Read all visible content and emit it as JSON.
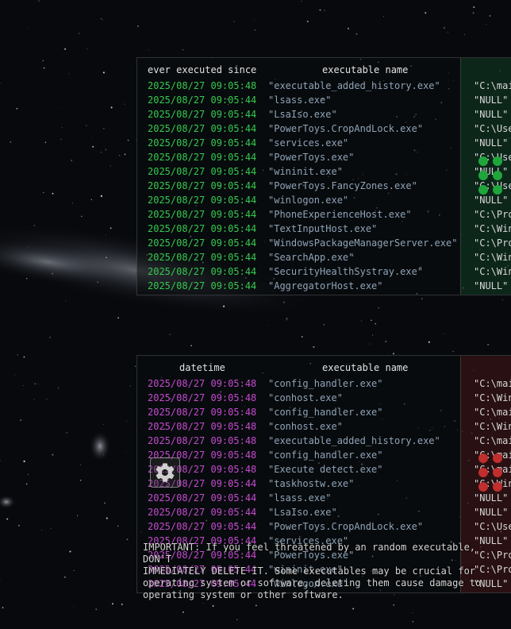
{
  "top_table": {
    "headers": [
      "ever executed since",
      "executable name"
    ],
    "rows": [
      {
        "date": "2025/08/27 09:05:48",
        "name": "\"executable_added_history.exe\"",
        "path": "\"C:\\mai"
      },
      {
        "date": "2025/08/27 09:05:44",
        "name": "\"lsass.exe\"",
        "path": "\"NULL\""
      },
      {
        "date": "2025/08/27 09:05:44",
        "name": "\"LsaIso.exe\"",
        "path": "\"NULL\""
      },
      {
        "date": "2025/08/27 09:05:44",
        "name": "\"PowerToys.CropAndLock.exe\"",
        "path": "\"C:\\Use"
      },
      {
        "date": "2025/08/27 09:05:44",
        "name": "\"services.exe\"",
        "path": "\"NULL\""
      },
      {
        "date": "2025/08/27 09:05:44",
        "name": "\"PowerToys.exe\"",
        "path": "\"C:\\Use"
      },
      {
        "date": "2025/08/27 09:05:44",
        "name": "\"wininit.exe\"",
        "path": "\"NULL\""
      },
      {
        "date": "2025/08/27 09:05:44",
        "name": "\"PowerToys.FancyZones.exe\"",
        "path": "\"C:\\Use"
      },
      {
        "date": "2025/08/27 09:05:44",
        "name": "\"winlogon.exe\"",
        "path": "\"NULL\""
      },
      {
        "date": "2025/08/27 09:05:44",
        "name": "\"PhoneExperienceHost.exe\"",
        "path": "\"C:\\Pro"
      },
      {
        "date": "2025/08/27 09:05:44",
        "name": "\"TextInputHost.exe\"",
        "path": "\"C:\\Win"
      },
      {
        "date": "2025/08/27 09:05:44",
        "name": "\"WindowsPackageManagerServer.exe\"",
        "path": "\"C:\\Pro"
      },
      {
        "date": "2025/08/27 09:05:44",
        "name": "\"SearchApp.exe\"",
        "path": "\"C:\\Win"
      },
      {
        "date": "2025/08/27 09:05:44",
        "name": "\"SecurityHealthSystray.exe\"",
        "path": "\"C:\\Win"
      },
      {
        "date": "2025/08/27 09:05:44",
        "name": "\"AggregatorHost.exe\"",
        "path": "\"NULL\""
      }
    ]
  },
  "bottom_table": {
    "headers": [
      "datetime",
      "executable name"
    ],
    "rows": [
      {
        "date": "2025/08/27 09:05:48",
        "name": "\"config_handler.exe\"",
        "path": "\"C:\\mai"
      },
      {
        "date": "2025/08/27 09:05:48",
        "name": "\"conhost.exe\"",
        "path": "\"C:\\Win"
      },
      {
        "date": "2025/08/27 09:05:48",
        "name": "\"config_handler.exe\"",
        "path": "\"C:\\mai"
      },
      {
        "date": "2025/08/27 09:05:48",
        "name": "\"conhost.exe\"",
        "path": "\"C:\\Win"
      },
      {
        "date": "2025/08/27 09:05:48",
        "name": "\"executable_added_history.exe\"",
        "path": "\"C:\\mai"
      },
      {
        "date": "2025/08/27 09:05:48",
        "name": "\"config_handler.exe\"",
        "path": "\"C:\\mai"
      },
      {
        "date": "2025/08/27 09:05:48",
        "name": "\"Execute detect.exe\"",
        "path": "\"C:\\mai"
      },
      {
        "date": "2025/08/27 09:05:44",
        "name": "\"taskhostw.exe\"",
        "path": "\"C:\\Win"
      },
      {
        "date": "2025/08/27 09:05:44",
        "name": "\"lsass.exe\"",
        "path": "\"NULL\""
      },
      {
        "date": "2025/08/27 09:05:44",
        "name": "\"LsaIso.exe\"",
        "path": "\"NULL\""
      },
      {
        "date": "2025/08/27 09:05:44",
        "name": "\"PowerToys.CropAndLock.exe\"",
        "path": "\"C:\\Use"
      },
      {
        "date": "2025/08/27 09:05:44",
        "name": "\"services.exe\"",
        "path": "\"NULL\""
      },
      {
        "date": "2025/08/27 09:05:44",
        "name": "\"PowerToys.exe\"",
        "path": "\"C:\\Pro"
      },
      {
        "date": "2025/08/27 09:05:44",
        "name": "\"wininit.exe\"",
        "path": "\"C:\\Pro"
      },
      {
        "date": "2025/08/27 09:05:44",
        "name": "\"winlogon.exe\"",
        "path": "\"NULL\""
      }
    ]
  },
  "settings": {
    "icon": "gear-icon"
  },
  "notice": {
    "text": "IMPORTANT: If you feel threatened by an random executable, DON'T\nIMMEDIATELY DELETE IT. Some executables may be crucial for\noperating system or software, deleting them cause damage to\noperating system or other software."
  },
  "colors": {
    "date_top": "#35c94e",
    "date_bottom": "#c44ad0",
    "name": "#8fa3b8",
    "status_ok": "#1fa63b",
    "status_alert": "#c02e2e"
  }
}
